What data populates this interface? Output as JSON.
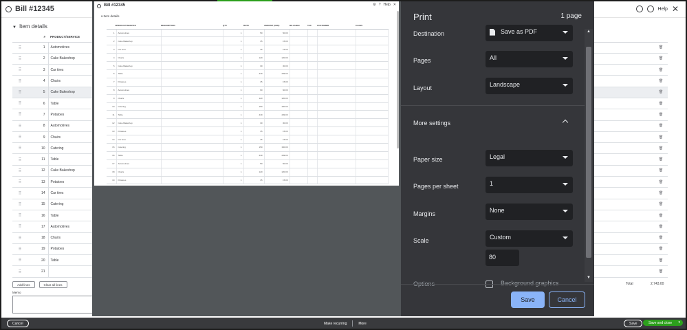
{
  "app": {
    "title": "Bill #12345",
    "help_label": "Help",
    "section_title": "Item details",
    "columns": {
      "num": "#",
      "product": "PRODUCT/SERVICE"
    },
    "rows": [
      {
        "num": "1",
        "product": "Automotives"
      },
      {
        "num": "2",
        "product": "Cake Bakeshop"
      },
      {
        "num": "3",
        "product": "Car tires"
      },
      {
        "num": "4",
        "product": "Chairs"
      },
      {
        "num": "5",
        "product": "Cake Bakeshop"
      },
      {
        "num": "6",
        "product": "Table"
      },
      {
        "num": "7",
        "product": "Potatoes"
      },
      {
        "num": "8",
        "product": "Automotives"
      },
      {
        "num": "9",
        "product": "Chairs"
      },
      {
        "num": "10",
        "product": "Catering"
      },
      {
        "num": "11",
        "product": "Table"
      },
      {
        "num": "12",
        "product": "Cake Bakeshop"
      },
      {
        "num": "13",
        "product": "Potatoes"
      },
      {
        "num": "14",
        "product": "Car tires"
      },
      {
        "num": "15",
        "product": "Catering"
      },
      {
        "num": "16",
        "product": "Table"
      },
      {
        "num": "17",
        "product": "Automotives"
      },
      {
        "num": "18",
        "product": "Chairs"
      },
      {
        "num": "19",
        "product": "Potatoes"
      },
      {
        "num": "20",
        "product": "Table"
      },
      {
        "num": "21",
        "product": ""
      }
    ],
    "add_lines": "Add lines",
    "clear_lines": "Clear all lines",
    "memo_label": "Memo",
    "total_label": "Total",
    "total_value": "2,743.00",
    "footer": {
      "cancel": "Cancel",
      "make_recurring": "Make recurring",
      "more": "More",
      "save": "Save",
      "save_close": "Save and close"
    }
  },
  "preview": {
    "title": "Bill #12345",
    "help_label": "Help",
    "section_title": "Item details",
    "columns": [
      "#",
      "PRODUCT/SERVICE",
      "DESCRIPTION",
      "QTY",
      "RATE",
      "AMOUNT (USD)",
      "BILLABLE",
      "TAX",
      "CUSTOMER",
      "CLASS"
    ],
    "rows": [
      {
        "n": "1",
        "p": "Automotives",
        "q": "1",
        "r": "50",
        "a": "50.00"
      },
      {
        "n": "2",
        "p": "Cake Bakeshop",
        "q": "1",
        "r": "15",
        "a": "15.00"
      },
      {
        "n": "3",
        "p": "Car tires",
        "q": "1",
        "r": "15",
        "a": "15.00"
      },
      {
        "n": "4",
        "p": "Chairs",
        "q": "1",
        "r": "120",
        "a": "120.00"
      },
      {
        "n": "5",
        "p": "Cake Bakeshop",
        "q": "1",
        "r": "30",
        "a": "30.00"
      },
      {
        "n": "6",
        "p": "Table",
        "q": "1",
        "r": "449",
        "a": "449.00"
      },
      {
        "n": "7",
        "p": "Potatoes",
        "q": "1",
        "r": "15",
        "a": "15.00"
      },
      {
        "n": "8",
        "p": "Automotives",
        "q": "1",
        "r": "60",
        "a": "60.00"
      },
      {
        "n": "9",
        "p": "Chairs",
        "q": "1",
        "r": "120",
        "a": "120.00"
      },
      {
        "n": "10",
        "p": "Catering",
        "q": "1",
        "r": "150",
        "a": "150.00"
      },
      {
        "n": "11",
        "p": "Table",
        "q": "1",
        "r": "449",
        "a": "449.00"
      },
      {
        "n": "12",
        "p": "Cake Bakeshop",
        "q": "1",
        "r": "30",
        "a": "30.00"
      },
      {
        "n": "13",
        "p": "Potatoes",
        "q": "1",
        "r": "15",
        "a": "15.00"
      },
      {
        "n": "14",
        "p": "Car tires",
        "q": "1",
        "r": "15",
        "a": "15.00"
      },
      {
        "n": "15",
        "p": "Catering",
        "q": "1",
        "r": "150",
        "a": "150.00"
      },
      {
        "n": "16",
        "p": "Table",
        "q": "1",
        "r": "449",
        "a": "449.00"
      },
      {
        "n": "17",
        "p": "Automotives",
        "q": "1",
        "r": "50",
        "a": "50.00"
      },
      {
        "n": "18",
        "p": "Chairs",
        "q": "1",
        "r": "120",
        "a": "120.00"
      },
      {
        "n": "19",
        "p": "Potatoes",
        "q": "1",
        "r": "15",
        "a": "15.00"
      }
    ]
  },
  "print": {
    "title": "Print",
    "page_count": "1 page",
    "destination_label": "Destination",
    "destination_value": "Save as PDF",
    "pages_label": "Pages",
    "pages_value": "All",
    "layout_label": "Layout",
    "layout_value": "Landscape",
    "more_settings_label": "More settings",
    "paper_size_label": "Paper size",
    "paper_size_value": "Legal",
    "pages_per_sheet_label": "Pages per sheet",
    "pages_per_sheet_value": "1",
    "margins_label": "Margins",
    "margins_value": "None",
    "scale_label": "Scale",
    "scale_value": "Custom",
    "scale_input": "80",
    "options_label": "Options",
    "checkbox_label": "Background graphics",
    "save_label": "Save",
    "cancel_label": "Cancel"
  },
  "colors": {
    "panel_bg": "#35363a",
    "accent_blue": "#8ab4f8",
    "green": "#2ca01c",
    "preview_bg": "#525659"
  }
}
